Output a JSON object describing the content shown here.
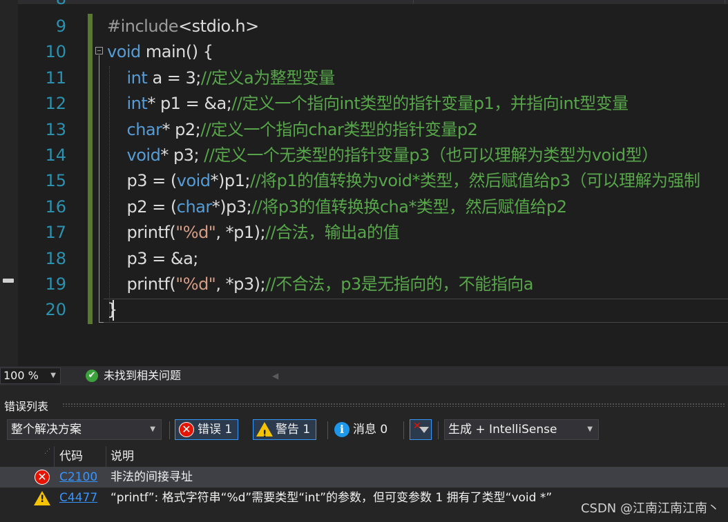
{
  "editor": {
    "partial_line_number": "8",
    "lines": [
      {
        "num": "9",
        "segments": [
          {
            "t": "#include",
            "c": "pre"
          },
          {
            "t": "<stdio.h>",
            "c": "plain"
          }
        ]
      },
      {
        "num": "10",
        "segments": [
          {
            "t": "void",
            "c": "kw"
          },
          {
            "t": " main() {",
            "c": "plain"
          }
        ]
      },
      {
        "num": "11",
        "segments": [
          {
            "t": "    ",
            "c": "plain"
          },
          {
            "t": "int",
            "c": "kw"
          },
          {
            "t": " a = 3;",
            "c": "plain"
          },
          {
            "t": "//定义a为整型变量",
            "c": "cmt"
          }
        ]
      },
      {
        "num": "12",
        "segments": [
          {
            "t": "    ",
            "c": "plain"
          },
          {
            "t": "int",
            "c": "kw"
          },
          {
            "t": "* p1 = &a;",
            "c": "plain"
          },
          {
            "t": "//定义一个指向int类型的指针变量p1，并指向int型变量",
            "c": "cmt"
          }
        ]
      },
      {
        "num": "13",
        "segments": [
          {
            "t": "    ",
            "c": "plain"
          },
          {
            "t": "char",
            "c": "kw"
          },
          {
            "t": "* p2;",
            "c": "plain"
          },
          {
            "t": "//定义一个指向char类型的指针变量p2",
            "c": "cmt"
          }
        ]
      },
      {
        "num": "14",
        "segments": [
          {
            "t": "    ",
            "c": "plain"
          },
          {
            "t": "void",
            "c": "kw"
          },
          {
            "t": "* p3; ",
            "c": "plain"
          },
          {
            "t": "//定义一个无类型的指针变量p3（也可以理解为类型为void型）",
            "c": "cmt"
          }
        ]
      },
      {
        "num": "15",
        "segments": [
          {
            "t": "    p3 = (",
            "c": "plain"
          },
          {
            "t": "void",
            "c": "kw"
          },
          {
            "t": "*)p1;",
            "c": "plain"
          },
          {
            "t": "//将p1的值转换为void*类型，然后赋值给p3（可以理解为强制",
            "c": "cmt"
          }
        ]
      },
      {
        "num": "16",
        "segments": [
          {
            "t": "    p2 = (",
            "c": "plain"
          },
          {
            "t": "char",
            "c": "kw"
          },
          {
            "t": "*)p3;",
            "c": "plain"
          },
          {
            "t": "//将p3的值转换换cha*类型，然后赋值给p2",
            "c": "cmt"
          }
        ]
      },
      {
        "num": "17",
        "segments": [
          {
            "t": "    printf(",
            "c": "plain"
          },
          {
            "t": "\"%d\"",
            "c": "str"
          },
          {
            "t": ", *p1);",
            "c": "plain"
          },
          {
            "t": "//合法，输出a的值",
            "c": "cmt"
          }
        ]
      },
      {
        "num": "18",
        "segments": [
          {
            "t": "    p3 = &a;",
            "c": "plain"
          }
        ]
      },
      {
        "num": "19",
        "segments": [
          {
            "t": "    printf(",
            "c": "plain"
          },
          {
            "t": "\"%d\"",
            "c": "str"
          },
          {
            "t": ", *p3);",
            "c": "plain"
          },
          {
            "t": "//不合法，p3是无指向的，不能指向a",
            "c": "cmt"
          }
        ]
      },
      {
        "num": "20",
        "segments": [
          {
            "t": "}",
            "c": "plain"
          }
        ]
      }
    ]
  },
  "status": {
    "zoom": "100 %",
    "issues_text": "未找到相关问题",
    "ok_glyph": "✔"
  },
  "error_list": {
    "title": "错误列表",
    "scope": "整个解决方案",
    "errors_btn": "错误 1",
    "warnings_btn": "警告 1",
    "messages_btn": "消息 0",
    "build_filter": "生成 + IntelliSense",
    "columns": {
      "code": "代码",
      "desc": "说明"
    },
    "rows": [
      {
        "icon": "error-icon",
        "code": "C2100",
        "desc": "非法的间接寻址"
      },
      {
        "icon": "warning-icon",
        "code": "C4477",
        "desc": "“printf”: 格式字符串“%d”需要类型“int”的参数，但可变参数 1 拥有了类型“void *”"
      }
    ]
  },
  "watermark": "CSDN @江南江南江南丶",
  "colors": {
    "keyword": "#569cd6",
    "comment": "#57a64a",
    "string": "#d69d85",
    "line_number": "#2b91af",
    "change_bar": "#577a2c",
    "error": "#e51400",
    "warning": "#f6c300",
    "info": "#1c97ea"
  }
}
